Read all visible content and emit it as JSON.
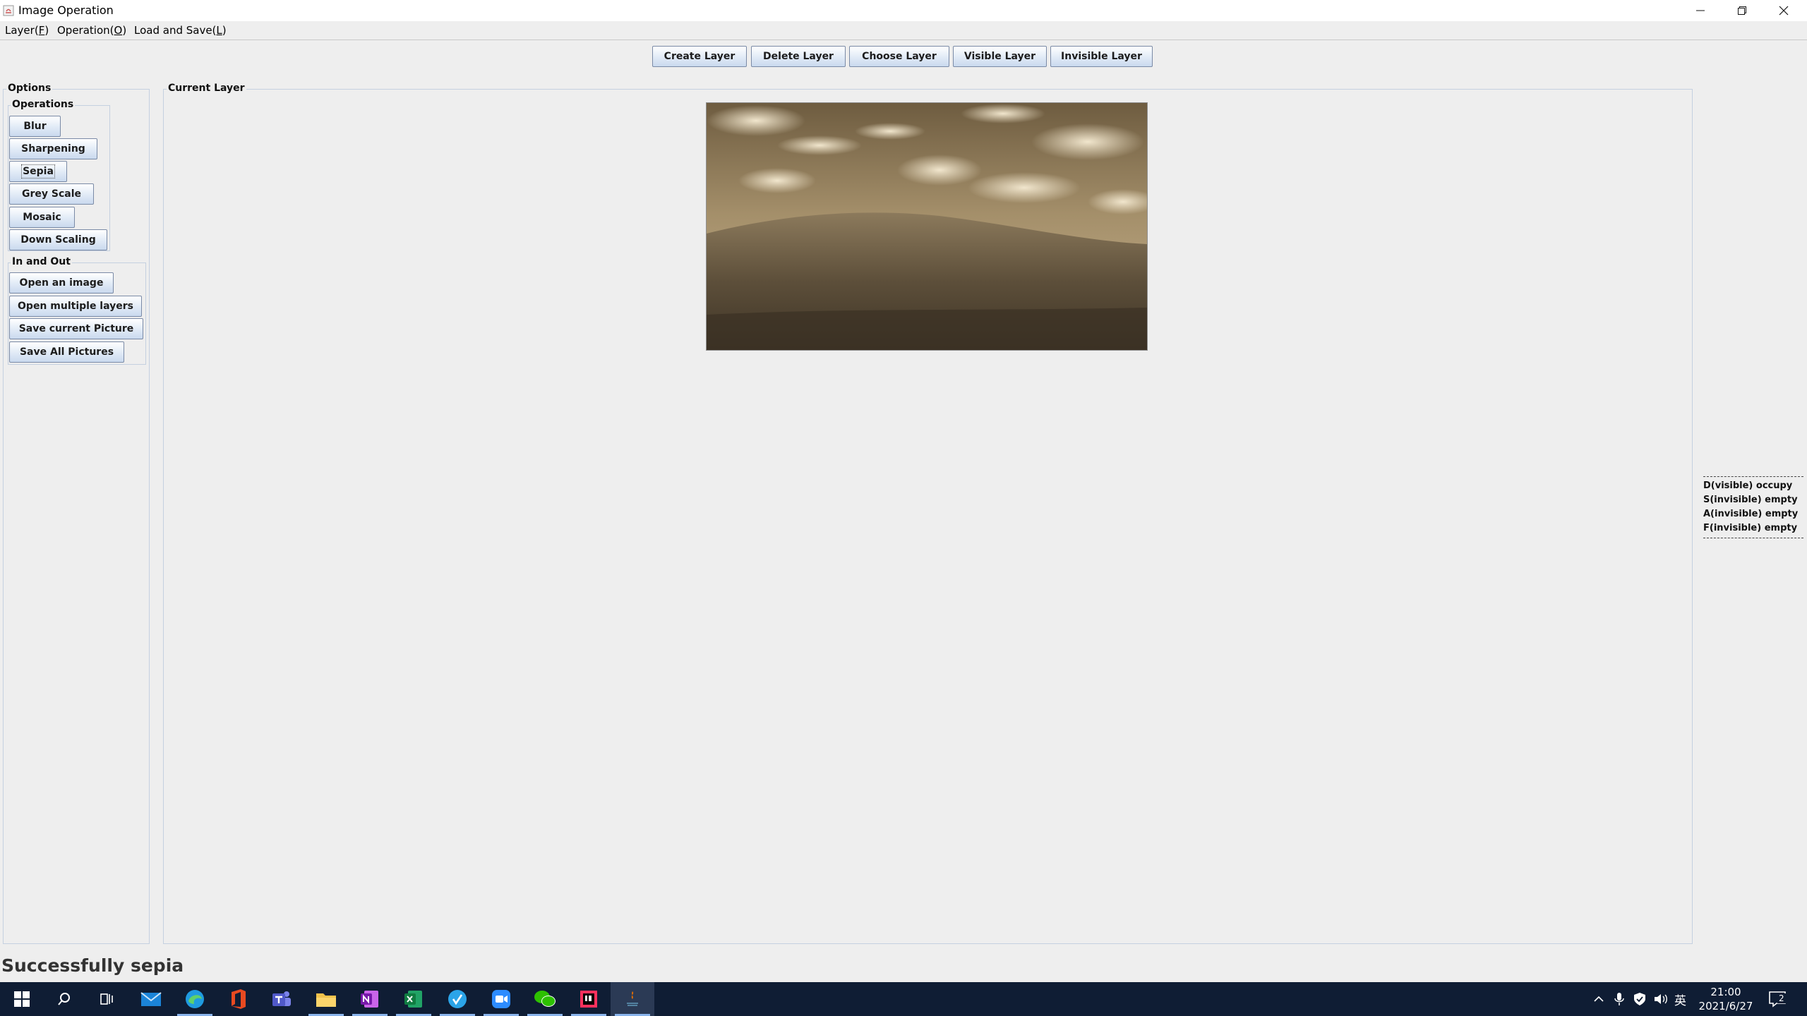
{
  "window": {
    "title": "Image Operation"
  },
  "menu": [
    {
      "label": "Layer(",
      "mnemonic": "F",
      "tail": ")"
    },
    {
      "label": "Operation(",
      "mnemonic": "O",
      "tail": ")"
    },
    {
      "label": "Load and Save(",
      "mnemonic": "L",
      "tail": ")"
    }
  ],
  "layer_toolbar": {
    "create": "Create Layer",
    "delete": "Delete Layer",
    "choose": "Choose Layer",
    "visible": "Visible Layer",
    "invisible": "Invisible Layer"
  },
  "options_panel": {
    "title": "Options",
    "operations": {
      "title": "Operations",
      "buttons": [
        "Blur",
        "Sharpening",
        "Sepia",
        "Grey Scale",
        "Mosaic",
        "Down Scaling"
      ]
    },
    "in_out": {
      "title": "In and Out",
      "buttons": [
        "Open an image",
        "Open multiple layers",
        "Save current Picture",
        "Save All Pictures"
      ]
    }
  },
  "canvas": {
    "title": "Current Layer",
    "image_tone": "sepia"
  },
  "layer_status": {
    "separator": "------------------------------",
    "lines": [
      "D(visible) occupy",
      "S(invisible) empty",
      "A(invisible) empty",
      "F(invisible) empty"
    ]
  },
  "status_message": "Successfully sepia",
  "taskbar": {
    "apps": [
      "windows-start",
      "search",
      "task-view",
      "mail",
      "edge",
      "office",
      "teams",
      "file-explorer",
      "onenote",
      "excel",
      "vscode-like",
      "zoom",
      "wechat",
      "intellij",
      "java"
    ],
    "tray": {
      "ime": "英",
      "time": "21:00",
      "date": "2021/6/27",
      "notifications": "2"
    }
  },
  "colors": {
    "taskbar_bg": "#0f1d34",
    "window_bg": "#eeeeee",
    "button_gradient_bottom": "#c9d9ee"
  }
}
